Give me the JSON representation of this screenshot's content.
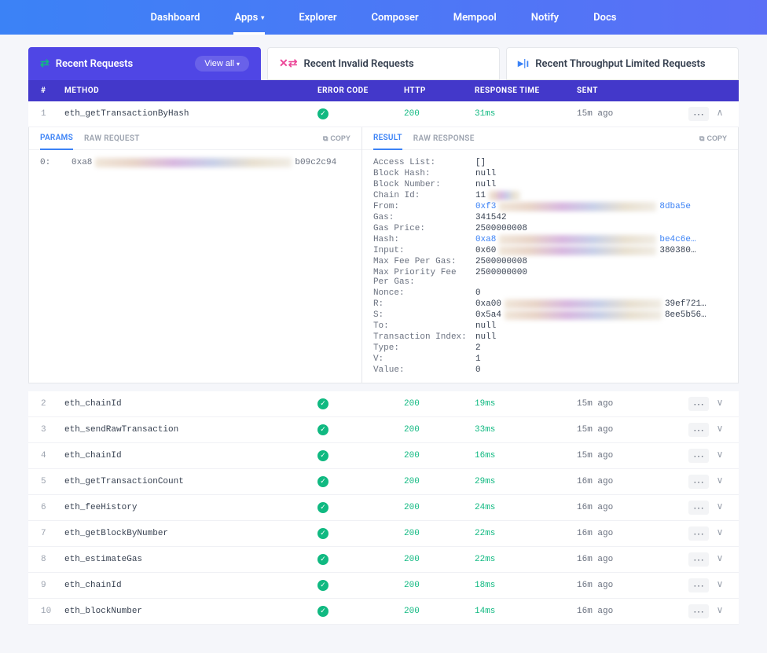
{
  "nav": {
    "items": [
      "Dashboard",
      "Apps",
      "Explorer",
      "Composer",
      "Mempool",
      "Notify",
      "Docs"
    ],
    "active_index": 1
  },
  "tabs": {
    "recent": "Recent Requests",
    "invalid": "Recent Invalid Requests",
    "throughput": "Recent Throughput Limited Requests",
    "view_all": "View all"
  },
  "headers": {
    "idx": "#",
    "method": "METHOD",
    "error": "ERROR CODE",
    "http": "HTTP",
    "time": "RESPONSE TIME",
    "sent": "SENT"
  },
  "rows": [
    {
      "idx": "1",
      "method": "eth_getTransactionByHash",
      "http": "200",
      "time": "31ms",
      "sent": "15m ago",
      "expanded": true
    },
    {
      "idx": "2",
      "method": "eth_chainId",
      "http": "200",
      "time": "19ms",
      "sent": "15m ago"
    },
    {
      "idx": "3",
      "method": "eth_sendRawTransaction",
      "http": "200",
      "time": "33ms",
      "sent": "15m ago"
    },
    {
      "idx": "4",
      "method": "eth_chainId",
      "http": "200",
      "time": "16ms",
      "sent": "15m ago"
    },
    {
      "idx": "5",
      "method": "eth_getTransactionCount",
      "http": "200",
      "time": "29ms",
      "sent": "16m ago"
    },
    {
      "idx": "6",
      "method": "eth_feeHistory",
      "http": "200",
      "time": "24ms",
      "sent": "16m ago"
    },
    {
      "idx": "7",
      "method": "eth_getBlockByNumber",
      "http": "200",
      "time": "22ms",
      "sent": "16m ago"
    },
    {
      "idx": "8",
      "method": "eth_estimateGas",
      "http": "200",
      "time": "22ms",
      "sent": "16m ago"
    },
    {
      "idx": "9",
      "method": "eth_chainId",
      "http": "200",
      "time": "18ms",
      "sent": "16m ago"
    },
    {
      "idx": "10",
      "method": "eth_blockNumber",
      "http": "200",
      "time": "14ms",
      "sent": "16m ago"
    }
  ],
  "detail": {
    "left_tabs": {
      "params": "PARAMS",
      "raw": "RAW REQUEST"
    },
    "right_tabs": {
      "result": "RESULT",
      "raw": "RAW RESPONSE"
    },
    "copy": "COPY",
    "params": {
      "key": "0:",
      "prefix": "0xa8",
      "suffix": "b09c2c94"
    },
    "result": [
      {
        "k": "Access List:",
        "v": "[]"
      },
      {
        "k": "Block Hash:",
        "v": "null"
      },
      {
        "k": "Block Number:",
        "v": "null"
      },
      {
        "k": "Chain Id:",
        "v": "11",
        "blur": true,
        "suffix": ""
      },
      {
        "k": "From:",
        "v": "0xf3",
        "blur": true,
        "suffix": "8dba5e",
        "link": true
      },
      {
        "k": "Gas:",
        "v": "341542"
      },
      {
        "k": "Gas Price:",
        "v": "2500000008"
      },
      {
        "k": "Hash:",
        "v": "0xa8",
        "blur": true,
        "suffix": "be4c6e…",
        "link": true
      },
      {
        "k": "Input:",
        "v": "0x60",
        "blur": true,
        "suffix": "380380…"
      },
      {
        "k": "Max Fee Per Gas:",
        "v": "2500000008"
      },
      {
        "k": "Max Priority Fee Per Gas:",
        "v": "2500000000"
      },
      {
        "k": "Nonce:",
        "v": "0"
      },
      {
        "k": "R:",
        "v": "0xa00",
        "blur": true,
        "suffix": "39ef721…"
      },
      {
        "k": "S:",
        "v": "0x5a4",
        "blur": true,
        "suffix": "8ee5b56…"
      },
      {
        "k": "To:",
        "v": "null"
      },
      {
        "k": "Transaction Index:",
        "v": "null"
      },
      {
        "k": "Type:",
        "v": "2"
      },
      {
        "k": "V:",
        "v": "1"
      },
      {
        "k": "Value:",
        "v": "0"
      }
    ]
  }
}
